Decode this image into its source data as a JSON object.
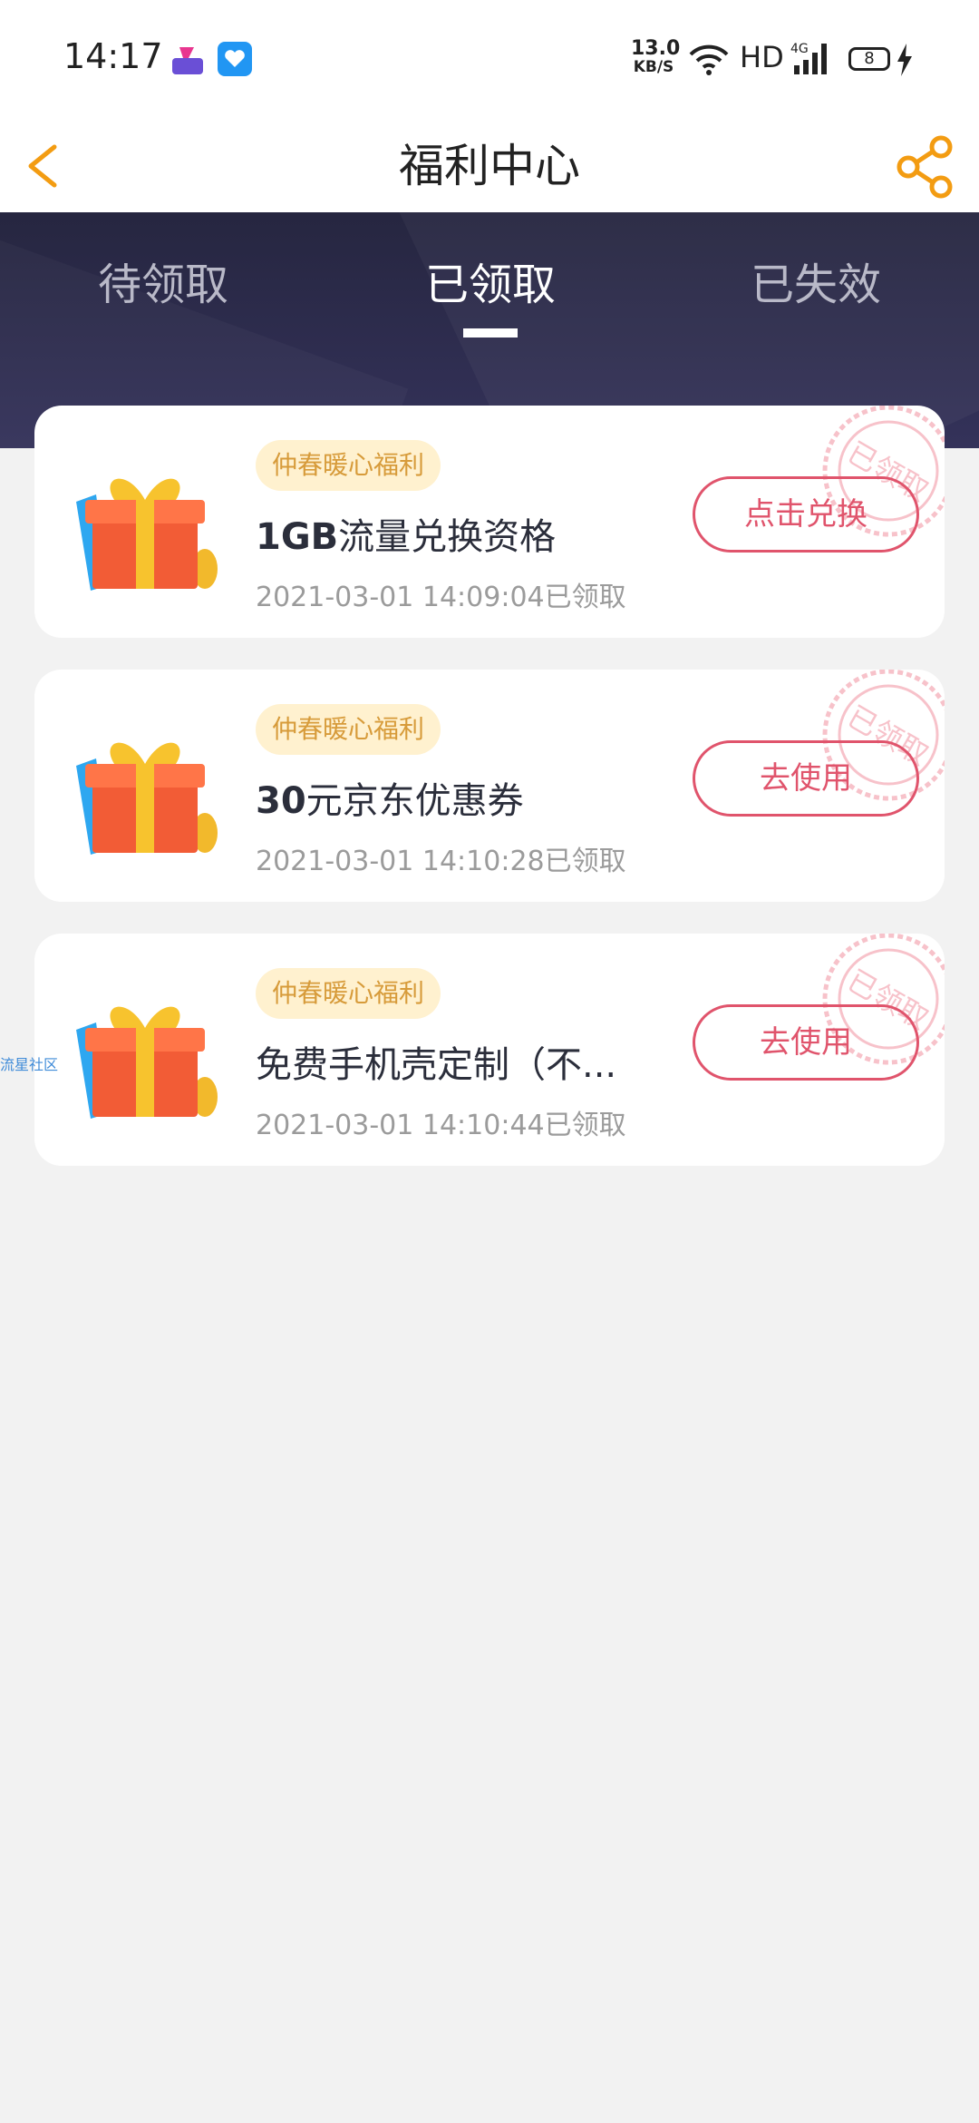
{
  "status_bar": {
    "time": "14:17",
    "net_speed_value": "13.0",
    "net_speed_unit": "KB/S",
    "hd_label": "HD",
    "network_label": "4G",
    "battery_level": "8",
    "icons": [
      "app-icon",
      "heart-shield-app-icon",
      "wifi-icon",
      "signal-icon",
      "battery-icon",
      "charging-bolt-icon"
    ]
  },
  "header": {
    "title": "福利中心",
    "back_icon": "chevron-left-icon",
    "share_icon": "share-icon",
    "accent_color": "#f39c12"
  },
  "tabs": [
    {
      "label": "待领取",
      "active": false
    },
    {
      "label": "已领取",
      "active": true
    },
    {
      "label": "已失效",
      "active": false
    }
  ],
  "cards": [
    {
      "tag": "仲春暖心福利",
      "title_bold": "1GB",
      "title_rest": "流量兑换资格",
      "time": "2021-03-01 14:09:04已领取",
      "action": "点击兑换",
      "stamp": "已领取"
    },
    {
      "tag": "仲春暖心福利",
      "title_bold": "30",
      "title_rest": "元京东优惠券",
      "time": "2021-03-01 14:10:28已领取",
      "action": "去使用",
      "stamp": "已领取"
    },
    {
      "tag": "仲春暖心福利",
      "title_bold": "",
      "title_rest": "免费手机壳定制（不...",
      "time": "2021-03-01 14:10:44已领取",
      "action": "去使用",
      "stamp": "已领取"
    }
  ],
  "side_label": "流星社区",
  "colors": {
    "tag_bg": "#fff1cf",
    "tag_text": "#d79b3a",
    "action_border": "#e0546c",
    "hero_bg": "#2a2945"
  }
}
